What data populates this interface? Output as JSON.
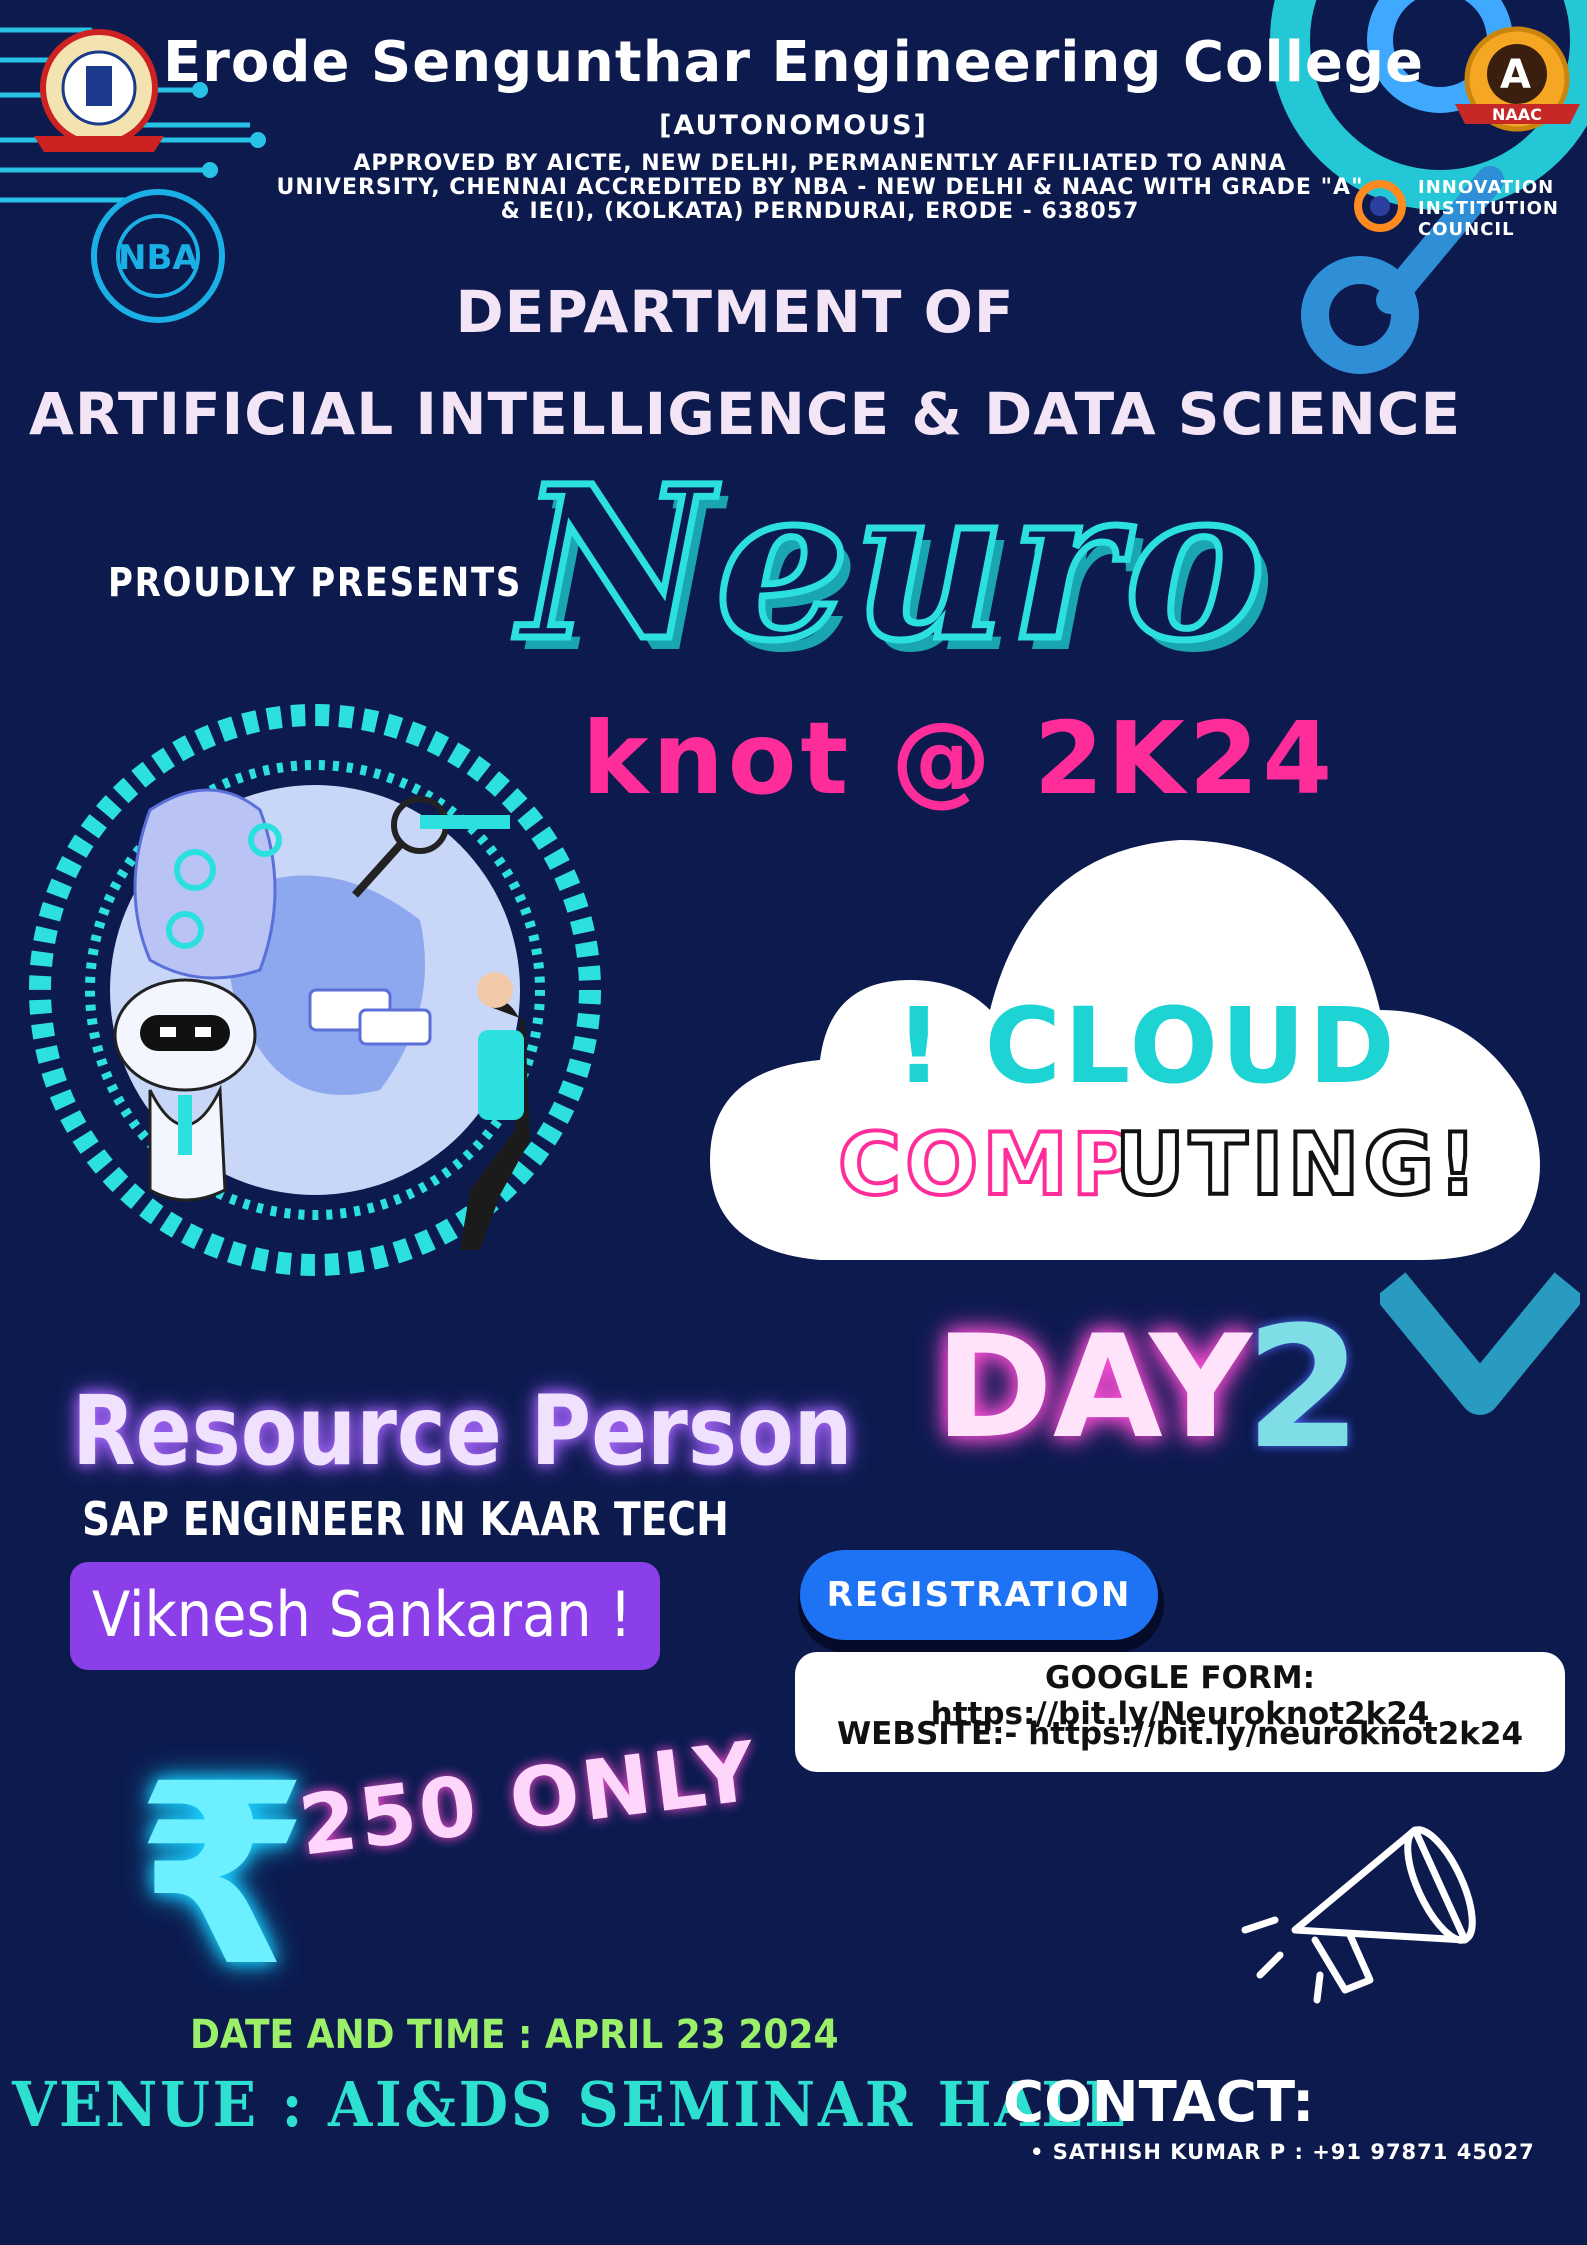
{
  "header": {
    "college_name": "Erode Sengunthar Engineering College",
    "autonomous": "[AUTONOMOUS]",
    "approved_line1": "APPROVED BY AICTE, NEW DELHI, PERMANENTLY AFFILIATED TO ANNA",
    "approved_line2": "UNIVERSITY, CHENNAI ACCREDITED BY NBA - NEW DELHI & NAAC WITH GRADE \"A\"",
    "approved_line3": "& IE(I), (KOLKATA) PERNDURAI, ERODE - 638057"
  },
  "logos": {
    "naac_grade": "A",
    "naac_label": "NAAC",
    "nba_label": "NBA",
    "iic_line1": "INNOVATION",
    "iic_line2": "INSTITUTION",
    "iic_line3": "COUNCIL"
  },
  "department": {
    "line1": "DEPARTMENT OF",
    "line2": "ARTIFICIAL INTELLIGENCE & DATA SCIENCE"
  },
  "event": {
    "presents": "PROUDLY PRESENTS",
    "name": "Neuro",
    "subtitle": "knot @ 2K24",
    "topic_line1": "! CLOUD",
    "topic_line2a": "COMP",
    "topic_line2b": "UTING!",
    "day_label": "DAY",
    "day_number": "2"
  },
  "resource": {
    "heading": "Resource Person",
    "role": "SAP ENGINEER IN  KAAR TECH",
    "name": "Viknesh Sankaran  !"
  },
  "registration": {
    "button": "REGISTRATION",
    "google_form": "GOOGLE FORM: https://bit.ly/Neuroknot2k24",
    "website": "WEBSITE:- https://bit.ly/neuroknot2k24"
  },
  "fee": {
    "symbol": "₹",
    "amount": "250  ONLY"
  },
  "footer": {
    "date_time": "DATE AND TIME : APRIL 23 2024",
    "venue": "VENUE : AI&DS SEMINAR HALL",
    "contact_label": "CONTACT:",
    "contact_person": "• SATHISH KUMAR P : +91 97871 45027"
  },
  "colors": {
    "background": "#0c1a4e",
    "accent_cyan": "#2de0e0",
    "accent_pink": "#ff2d9a",
    "accent_purple": "#8a3fe8",
    "button_blue": "#1e73f5",
    "date_green": "#9cf069"
  }
}
